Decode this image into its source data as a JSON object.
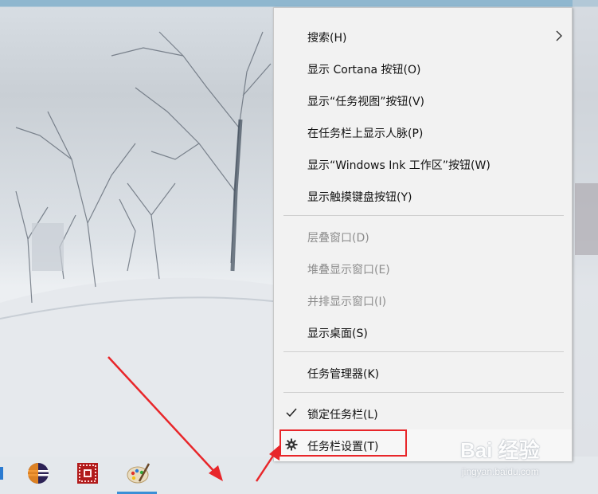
{
  "context_menu": {
    "items": [
      {
        "label": "搜索(H)",
        "has_submenu": true,
        "disabled": false
      },
      {
        "label": "显示 Cortana 按钮(O)",
        "disabled": false
      },
      {
        "label": "显示“任务视图”按钮(V)",
        "disabled": false
      },
      {
        "label": "在任务栏上显示人脉(P)",
        "disabled": false
      },
      {
        "label": "显示“Windows Ink 工作区”按钮(W)",
        "disabled": false
      },
      {
        "label": "显示触摸键盘按钮(Y)",
        "disabled": false
      },
      {
        "label": "层叠窗口(D)",
        "disabled": true
      },
      {
        "label": "堆叠显示窗口(E)",
        "disabled": true
      },
      {
        "label": "并排显示窗口(I)",
        "disabled": true
      },
      {
        "label": "显示桌面(S)",
        "disabled": false
      },
      {
        "label": "任务管理器(K)",
        "disabled": false
      },
      {
        "label": "锁定任务栏(L)",
        "checked": true,
        "disabled": false
      },
      {
        "label": "任务栏设置(T)",
        "icon": "gear-icon",
        "highlighted": true,
        "disabled": false
      }
    ]
  },
  "taskbar": {
    "apps": [
      {
        "name": "eclipse-icon"
      },
      {
        "name": "app-red-icon"
      },
      {
        "name": "paint-palette-icon",
        "active": true
      }
    ]
  },
  "watermark": {
    "logo": "Bai 经验",
    "url": "jingyan.baidu.com"
  },
  "colors": {
    "menu_bg": "#f2f2f2",
    "highlight_border": "#e8262a",
    "arrow": "#e8262a"
  }
}
